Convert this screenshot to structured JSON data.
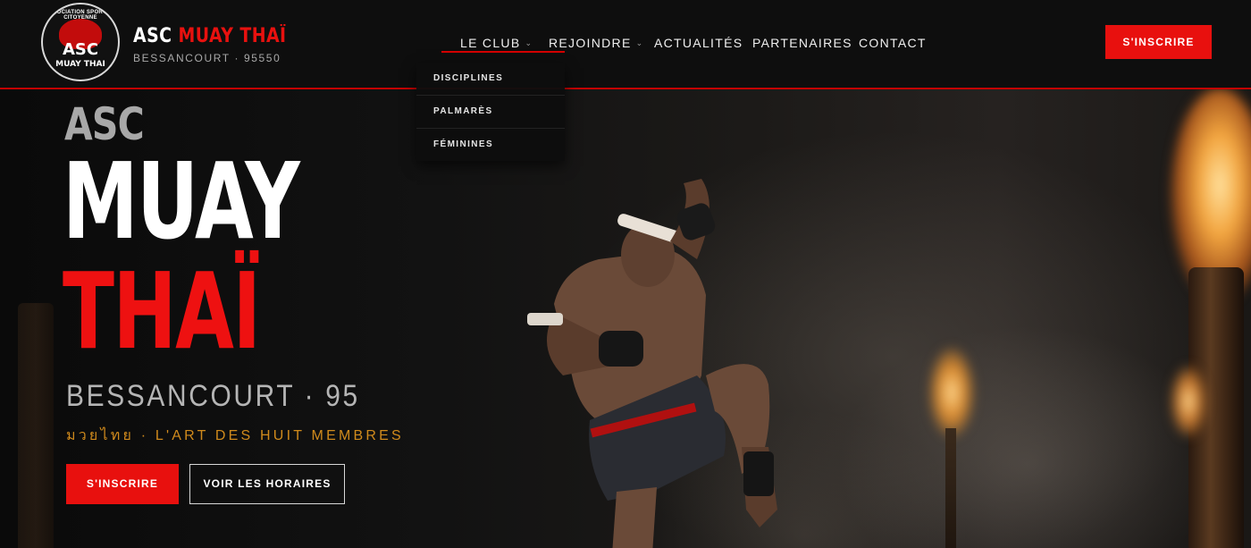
{
  "header": {
    "logo": {
      "arc_text": "ASSOCIATION SPORTIVE CITOYENNE",
      "main_text": "ASC",
      "sub_text": "MUAY THAI"
    },
    "brand": {
      "title_white": "ASC",
      "title_red": "MUAY THAÏ",
      "subtitle": "BESSANCOURT · 95550"
    },
    "nav": [
      {
        "label": "LE CLUB",
        "has_dropdown": true,
        "active": true
      },
      {
        "label": "REJOINDRE",
        "has_dropdown": true,
        "active": false
      },
      {
        "label": "ACTUALITÉS",
        "has_dropdown": false,
        "active": false
      },
      {
        "label": "PARTENAIRES",
        "has_dropdown": false,
        "active": false
      },
      {
        "label": "CONTACT",
        "has_dropdown": false,
        "active": false
      }
    ],
    "caret": "⌄",
    "cta_label": "S'INSCRIRE"
  },
  "dropdown": {
    "items": [
      "DISCIPLINES",
      "PALMARÈS",
      "FÉMININES"
    ]
  },
  "hero": {
    "line1": "ASC",
    "line2": "MUAY",
    "line3": "THAÏ",
    "location": "BESSANCOURT · 95",
    "tagline": "มวยไทย · L'ART DES HUIT MEMBRES",
    "primary_button": "S'INSCRIRE",
    "secondary_button": "VOIR LES HORAIRES"
  },
  "colors": {
    "accent_red": "#e8100e",
    "tagline_orange": "#d08a1c",
    "header_bg": "#0e0e0e"
  }
}
